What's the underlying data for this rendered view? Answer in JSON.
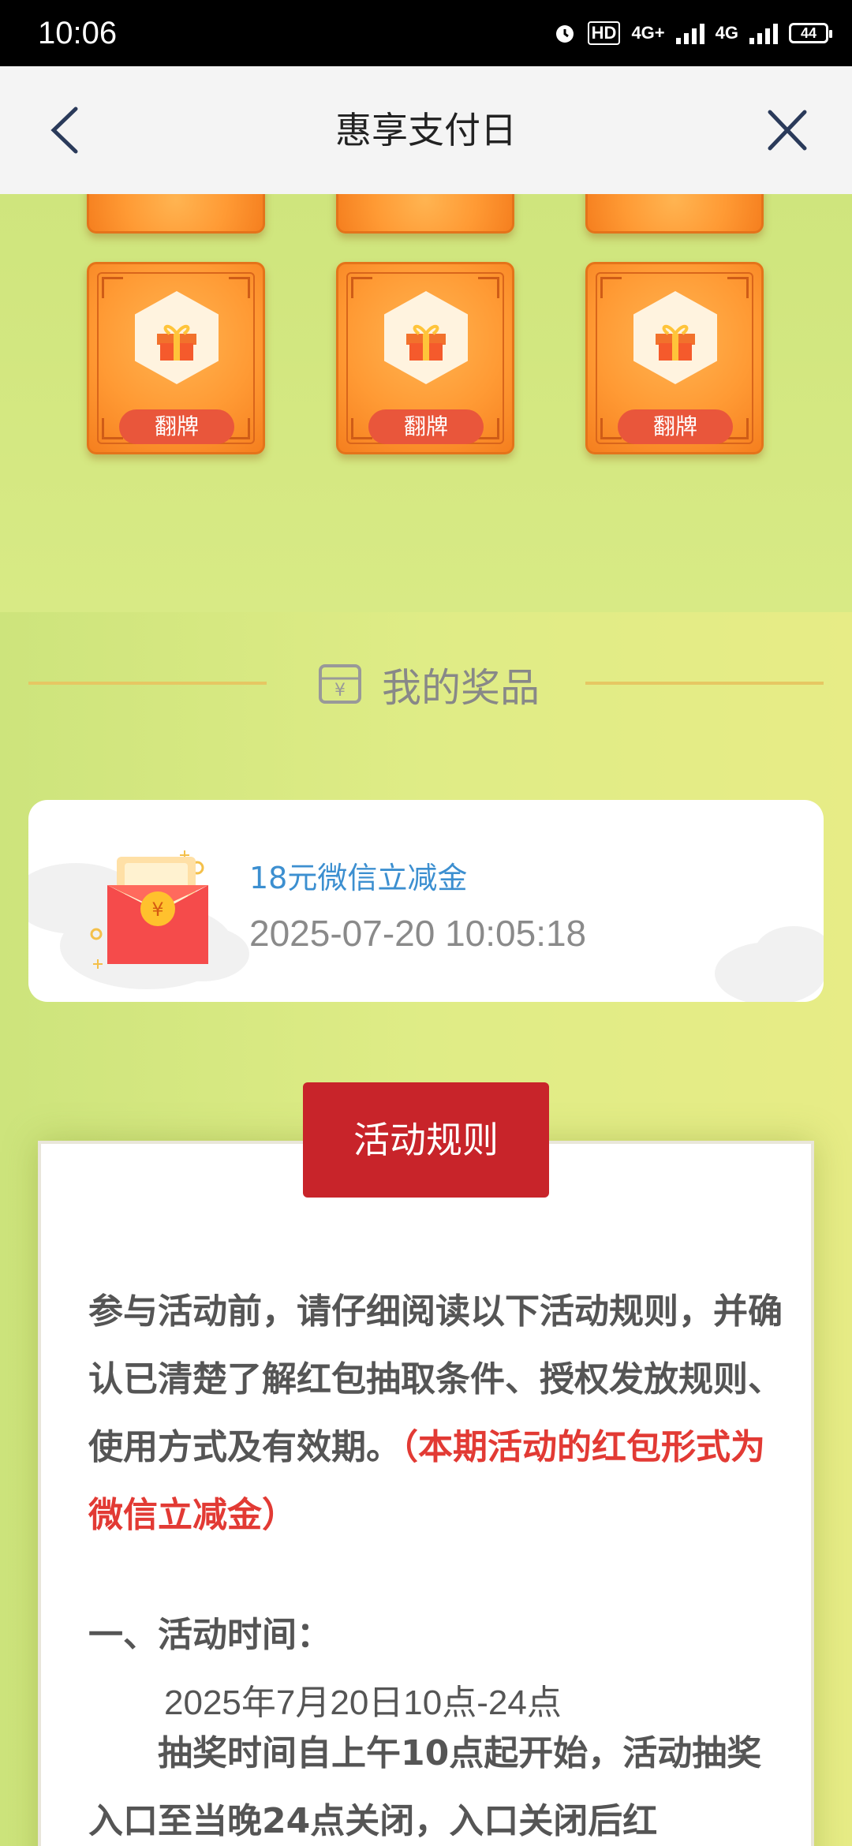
{
  "status_bar": {
    "time": "10:06",
    "hd": "HD",
    "net1": "4G+",
    "net2": "4G",
    "battery": "44"
  },
  "nav": {
    "title": "惠享支付日",
    "back_icon": "chevron-left-icon",
    "close_icon": "close-icon"
  },
  "cards": {
    "flip_label": "翻牌",
    "count": 6
  },
  "prizes": {
    "title": "我的奖品",
    "items": [
      {
        "name": "18元微信立减金",
        "datetime": "2025-07-20 10:05:18"
      }
    ]
  },
  "rules": {
    "tab_label": "活动规则",
    "intro": "参与活动前，请仔细阅读以下活动规则，并确认已清楚了解红包抽取条件、授权发放规则、使用方式及有效期。",
    "intro_highlight": "（本期活动的红包形式为微信立减金）",
    "section1_title": "一、活动时间：",
    "section1_time": "2025年7月20日10点-24点",
    "section1_text": "抽奖时间自上午10点起开始，活动抽奖入口至当晚24点关闭，入口关闭后红"
  },
  "colors": {
    "accent_red": "#c8242a",
    "link_blue": "#3c8fd0",
    "card_orange": "#ff9a34"
  }
}
